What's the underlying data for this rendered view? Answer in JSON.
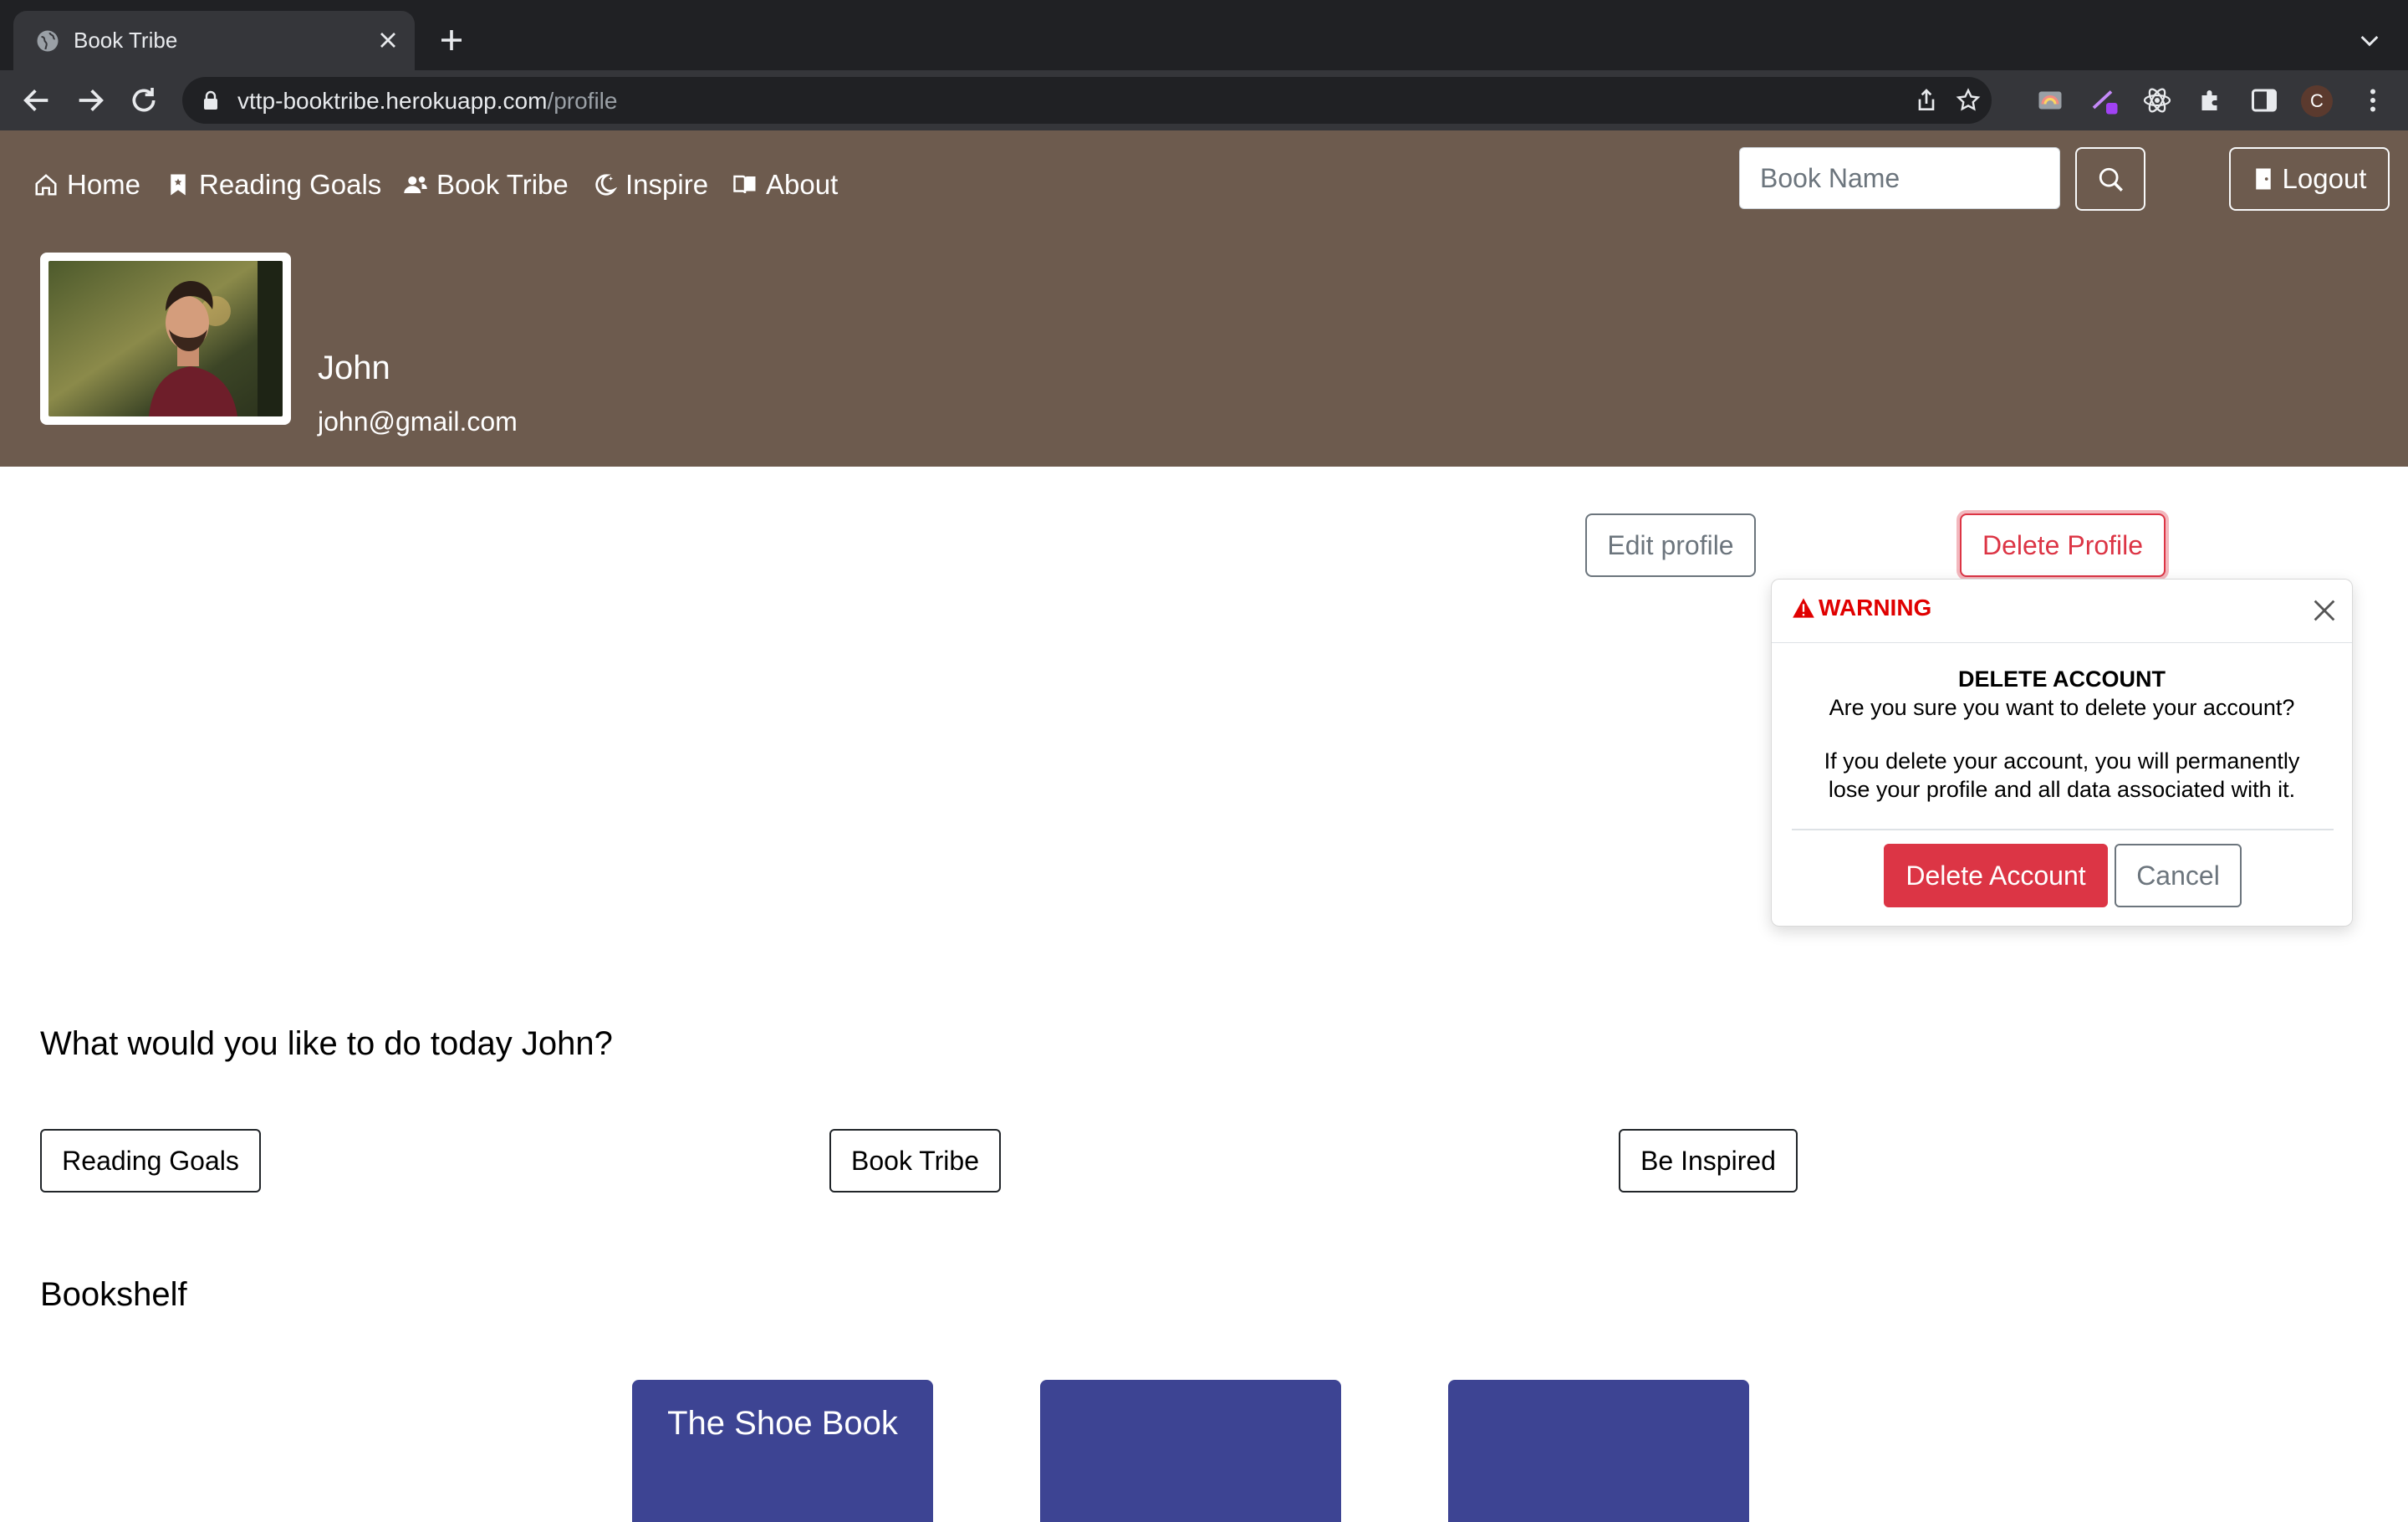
{
  "browser": {
    "tab_title": "Book Tribe",
    "url_host": "vttp-booktribe.herokuapp.com",
    "url_path": "/profile",
    "profile_initial": "C"
  },
  "nav": {
    "links": [
      {
        "label": "Home",
        "icon": "house-icon"
      },
      {
        "label": "Reading Goals",
        "icon": "bookmark-icon"
      },
      {
        "label": "Book Tribe",
        "icon": "people-icon"
      },
      {
        "label": "Inspire",
        "icon": "moon-stars-icon"
      },
      {
        "label": "About",
        "icon": "book-icon"
      }
    ],
    "search_placeholder": "Book Name",
    "logout_label": "Logout"
  },
  "profile": {
    "name": "John",
    "email": "john@gmail.com",
    "edit_label": "Edit profile",
    "delete_label": "Delete Profile"
  },
  "popover": {
    "header": "WARNING",
    "title": "DELETE ACCOUNT",
    "question": "Are you sure you want to delete your account?",
    "message_line1": "If you delete your account, you will permanently",
    "message_line2": "lose your profile and all data associated with it.",
    "confirm_label": "Delete Account",
    "cancel_label": "Cancel"
  },
  "main": {
    "prompt": "What would you like to do today John?",
    "actions": [
      "Reading Goals",
      "Book Tribe",
      "Be Inspired"
    ],
    "bookshelf_title": "Bookshelf",
    "books": [
      "The Shoe Book",
      "",
      ""
    ]
  },
  "colors": {
    "header_bg": "#6d5b4e",
    "danger": "#dc3545",
    "book_card": "#3d4493",
    "warning_text": "#e00000"
  }
}
